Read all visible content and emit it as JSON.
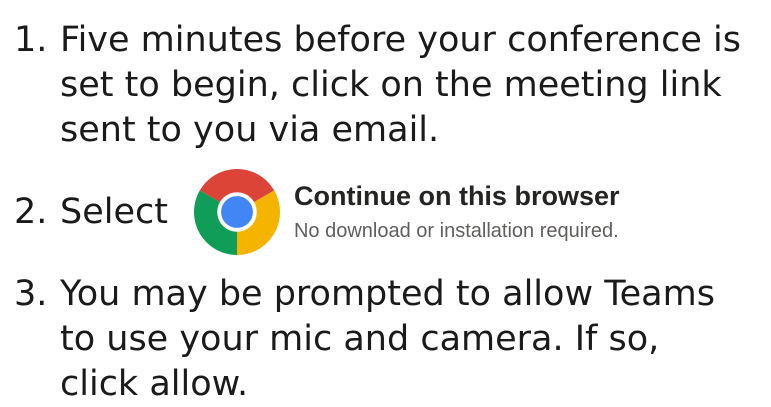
{
  "steps": [
    {
      "number": "1.",
      "text": "Five minutes before your conference is\nset to begin, click on the meeting link\nsent to you via email."
    },
    {
      "number": "2.",
      "text": "Select",
      "option": {
        "icon": "chrome-icon",
        "title": "Continue on this browser",
        "subtitle": "No download or installation required."
      }
    },
    {
      "number": "3.",
      "text": "You may be prompted to allow Teams\nto use your mic and camera.  If so,\nclick allow."
    }
  ],
  "colors": {
    "chrome_red": "#DB4437",
    "chrome_yellow": "#F4B400",
    "chrome_green": "#0F9D58",
    "chrome_blue": "#4285F4",
    "title": "#252423",
    "subtitle": "#605e5c"
  }
}
